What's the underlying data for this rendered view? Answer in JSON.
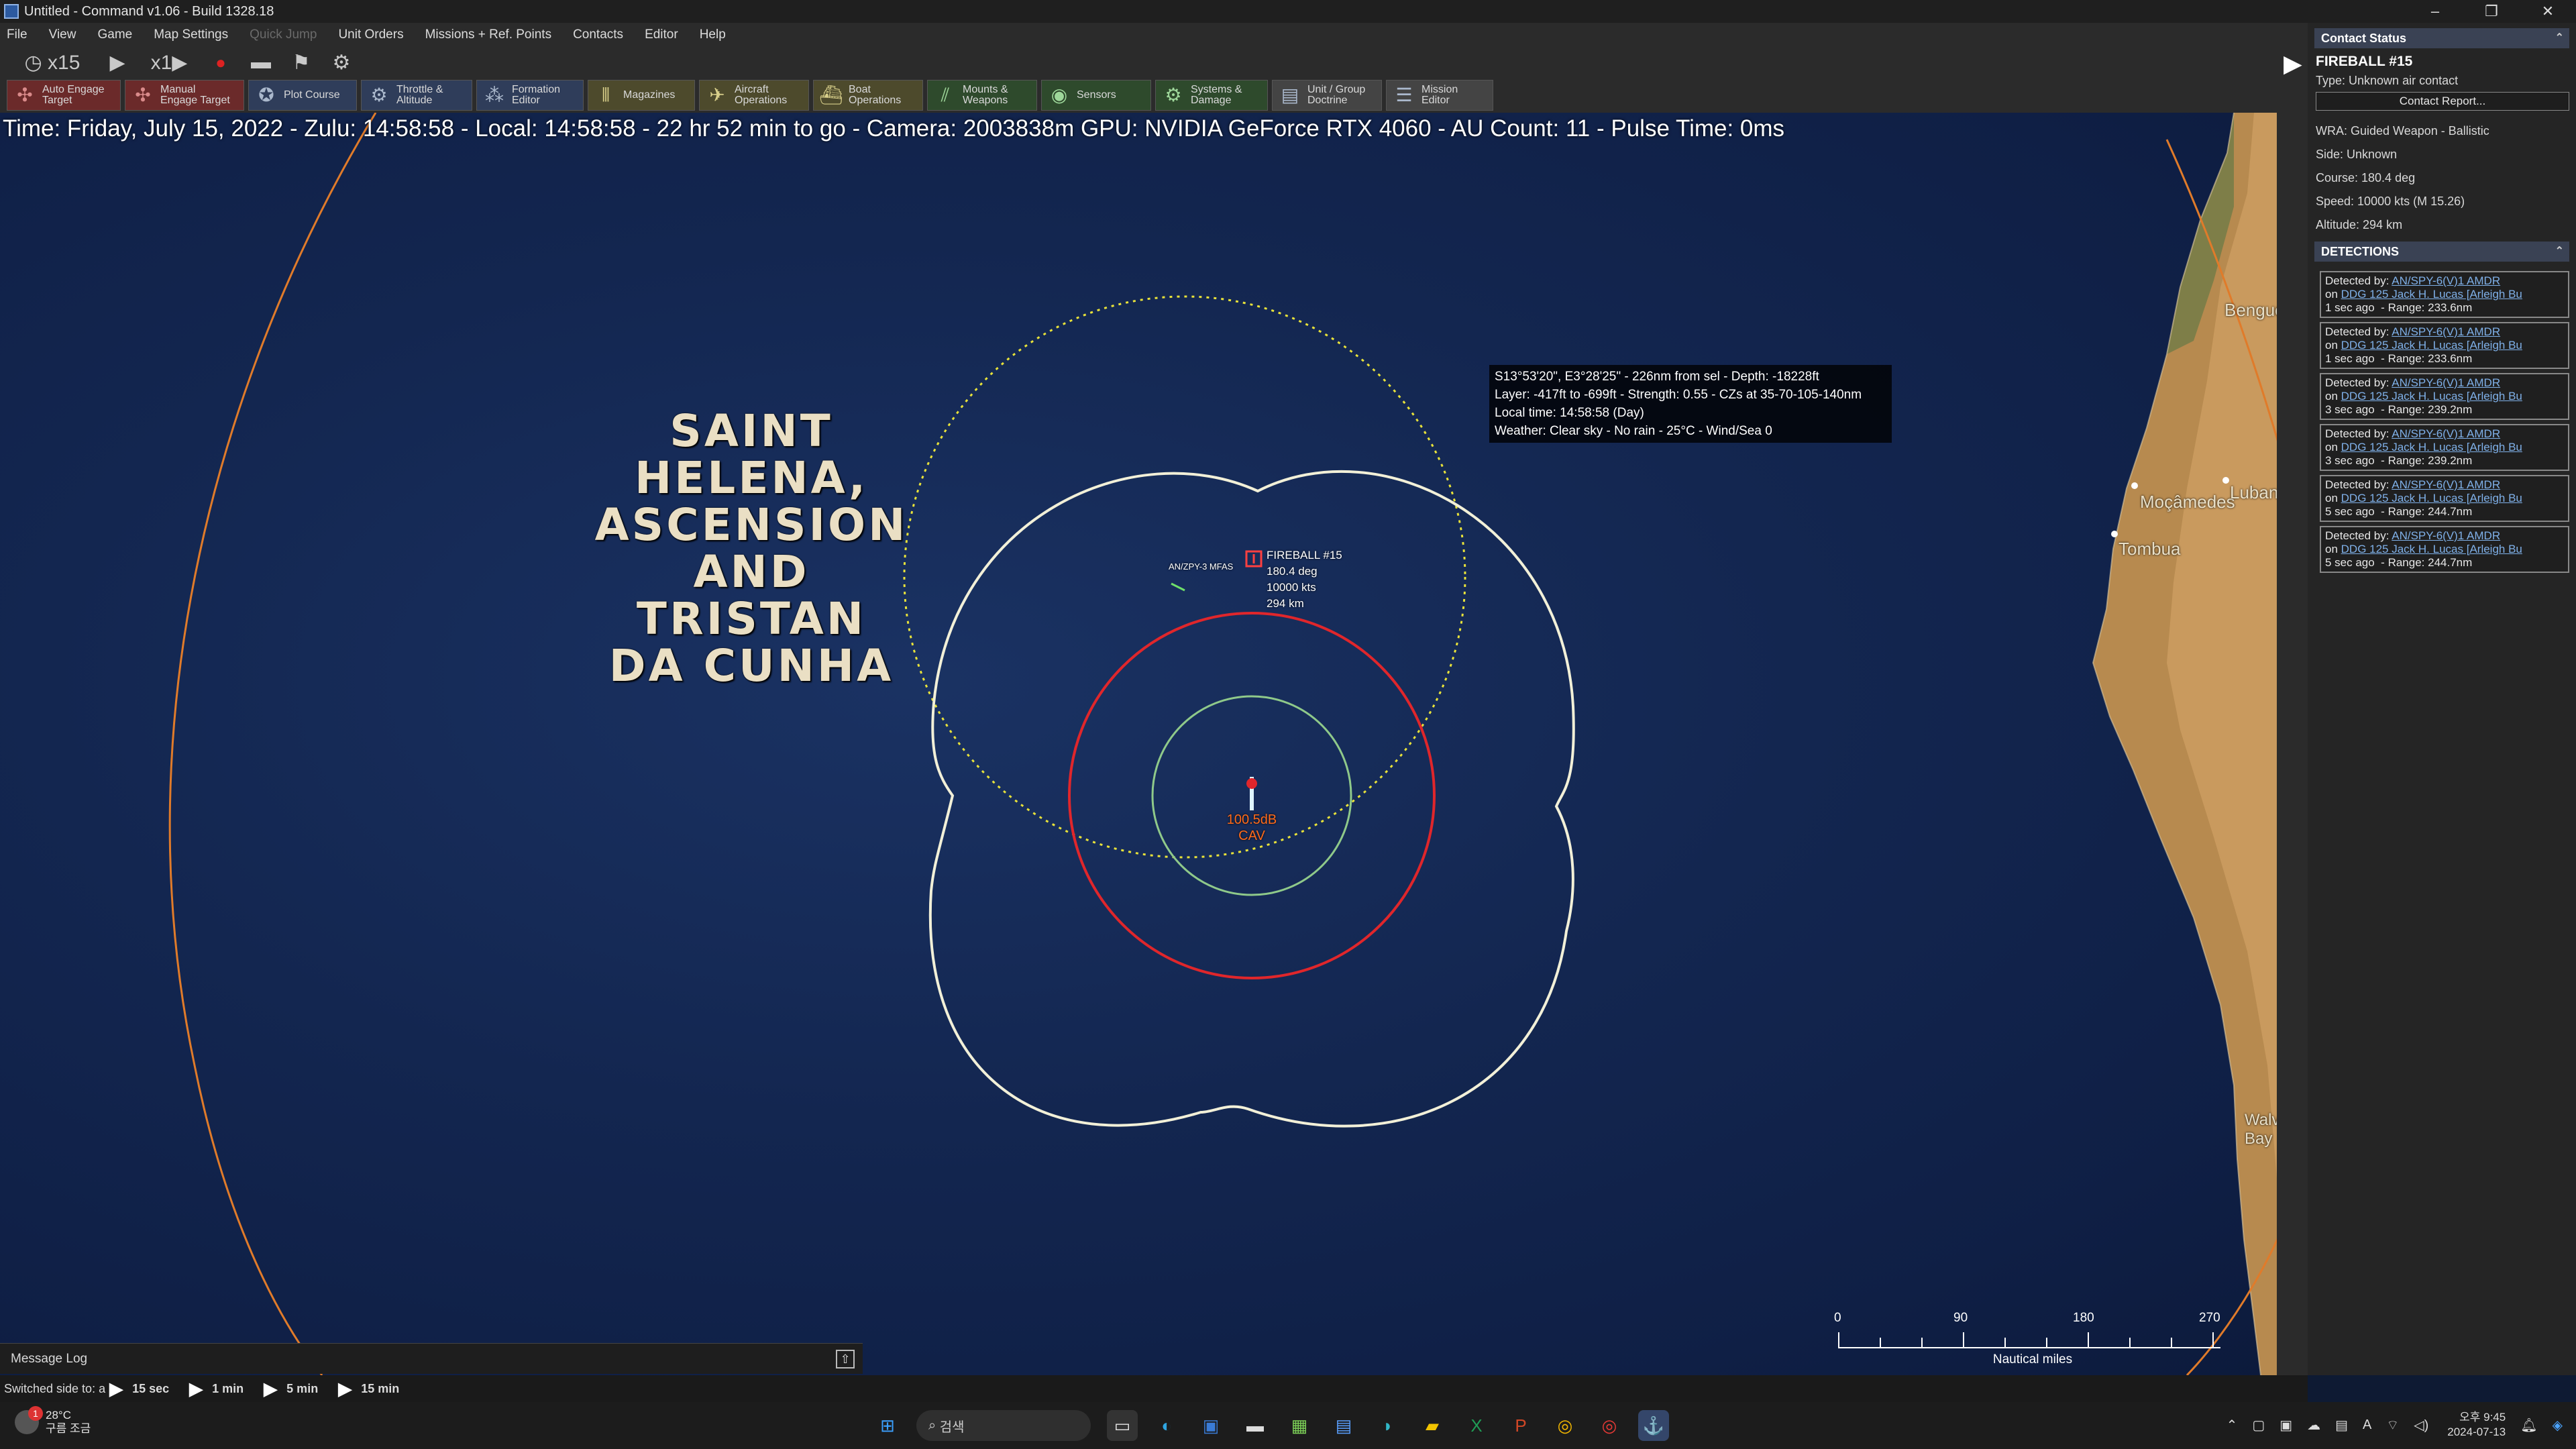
{
  "window": {
    "title": "Untitled - Command v1.06 - Build 1328.18",
    "minimize": "–",
    "maximize": "❐",
    "close": "✕"
  },
  "menu": [
    "File",
    "View",
    "Game",
    "Map Settings",
    "Quick Jump",
    "Unit Orders",
    "Missions + Ref. Points",
    "Contacts",
    "Editor",
    "Help"
  ],
  "time_controls": {
    "clock_label": "◷ x15",
    "play": "▶",
    "speed": "x1▶",
    "record": "●"
  },
  "toolbar": [
    {
      "label1": "Auto Engage",
      "label2": "Target",
      "icon": "crosshair-icon"
    },
    {
      "label1": "Manual",
      "label2": "Engage Target",
      "icon": "crosshair-icon"
    },
    {
      "label1": "Plot Course",
      "label2": "",
      "icon": "compass-icon"
    },
    {
      "label1": "Throttle &",
      "label2": "Altitude",
      "icon": "gear-icon"
    },
    {
      "label1": "Formation",
      "label2": "Editor",
      "icon": "formation-icon"
    },
    {
      "label1": "Magazines",
      "label2": "",
      "icon": "ammo-icon"
    },
    {
      "label1": "Aircraft",
      "label2": "Operations",
      "icon": "aircraft-icon"
    },
    {
      "label1": "Boat",
      "label2": "Operations",
      "icon": "boat-icon"
    },
    {
      "label1": "Mounts &",
      "label2": "Weapons",
      "icon": "weapons-icon"
    },
    {
      "label1": "Sensors",
      "label2": "",
      "icon": "radar-icon"
    },
    {
      "label1": "Systems &",
      "label2": "Damage",
      "icon": "gear-icon"
    },
    {
      "label1": "Unit / Group",
      "label2": "Doctrine",
      "icon": "doctrine-icon"
    },
    {
      "label1": "Mission",
      "label2": "Editor",
      "icon": "mission-icon"
    }
  ],
  "map": {
    "status_line": "Time: Friday, July 15, 2022 - Zulu: 14:58:58 - Local: 14:58:58 - 22 hr 52 min to go -  Camera: 2003838m  GPU: NVIDIA GeForce RTX 4060 - AU Count: 11 - Pulse Time: 0ms",
    "region_label": [
      "SAINT",
      "HELENA,",
      "ASCENSION",
      "AND TRISTAN",
      "DA CUNHA"
    ],
    "cursor_info": [
      "S13°53'20\", E3°28'25\" - 226nm from sel - Depth: -18228ft",
      "Layer: -417ft to -699ft - Strength: 0.55 - CZs at 35-70-105-140nm",
      "Local time: 14:58:58 (Day)",
      "Weather: Clear sky - No rain - 25°C - Wind/Sea 0"
    ],
    "contact": {
      "name": "FIREBALL #15",
      "course": "180.4 deg",
      "speed": "10000 kts",
      "altitude": "294 km"
    },
    "sensor_label": "AN/ZPY-3 MFAS",
    "own_unit": {
      "line1": "100.5dB",
      "line2": "CAV"
    },
    "places": [
      "Benguela",
      "Moçâmedes",
      "Lubango",
      "Tombua",
      "Walvis Bay"
    ],
    "scalebar": {
      "labels": [
        "0",
        "90",
        "180",
        "270"
      ],
      "unit": "Nautical miles"
    },
    "colors": {
      "ocean": "#132650",
      "range_ring_white": "#f2f0d8",
      "range_ring_red": "#e0262b",
      "range_ring_green": "#8fc98a",
      "range_ring_yellow": "#e8e23a",
      "range_ring_orange": "#e07b2a"
    }
  },
  "message_log": {
    "label": "Message Log"
  },
  "compression": {
    "switched": "Switched side to: a",
    "steps": [
      "15 sec",
      "1 min",
      "5 min",
      "15 min"
    ]
  },
  "panel": {
    "contact_status_title": "Contact Status",
    "name": "FIREBALL #15",
    "type": "Type: Unknown air contact",
    "report_button": "Contact Report...",
    "wra": "WRA: Guided Weapon - Ballistic",
    "side": "Side: Unknown",
    "course": "Course: 180.4 deg",
    "speed": "Speed: 10000 kts (M 15.26)",
    "altitude": "Altitude: 294 km",
    "detections_title": "DETECTIONS",
    "detections": [
      {
        "sensor": "AN/SPY-6(V)1 AMDR",
        "platform": "DDG 125 Jack H. Lucas [Arleigh Bu",
        "ago": "1 sec ago",
        "range": "Range: 233.6nm"
      },
      {
        "sensor": "AN/SPY-6(V)1 AMDR",
        "platform": "DDG 125 Jack H. Lucas [Arleigh Bu",
        "ago": "1 sec ago",
        "range": "Range: 233.6nm"
      },
      {
        "sensor": "AN/SPY-6(V)1 AMDR",
        "platform": "DDG 125 Jack H. Lucas [Arleigh Bu",
        "ago": "3 sec ago",
        "range": "Range: 239.2nm"
      },
      {
        "sensor": "AN/SPY-6(V)1 AMDR",
        "platform": "DDG 125 Jack H. Lucas [Arleigh Bu",
        "ago": "3 sec ago",
        "range": "Range: 239.2nm"
      },
      {
        "sensor": "AN/SPY-6(V)1 AMDR",
        "platform": "DDG 125 Jack H. Lucas [Arleigh Bu",
        "ago": "5 sec ago",
        "range": "Range: 244.7nm"
      },
      {
        "sensor": "AN/SPY-6(V)1 AMDR",
        "platform": "DDG 125 Jack H. Lucas [Arleigh Bu",
        "ago": "5 sec ago",
        "range": "Range: 244.7nm"
      }
    ]
  },
  "taskbar": {
    "weather_temp": "28°C",
    "weather_desc": "구름 조금",
    "weather_badge": "1",
    "search": "검색",
    "clock_time": "오후 9:45",
    "clock_date": "2024-07-13"
  }
}
